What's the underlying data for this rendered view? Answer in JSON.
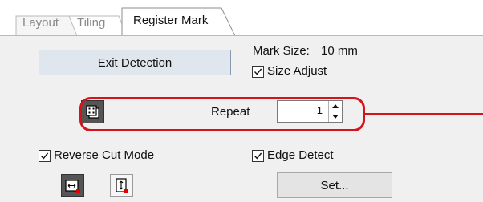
{
  "tabs": [
    {
      "label": "Layout",
      "active": false
    },
    {
      "label": "Tiling",
      "active": false
    },
    {
      "label": "Register Mark",
      "active": true
    }
  ],
  "exit_button": {
    "label": "Exit Detection"
  },
  "mark_size": {
    "label": "Mark Size:",
    "value": "10 mm"
  },
  "size_adjust": {
    "label": "Size Adjust",
    "checked": true
  },
  "repeat": {
    "label": "Repeat",
    "value": "1",
    "icon": "copies-icon"
  },
  "reverse_cut_mode": {
    "label": "Reverse Cut Mode",
    "checked": true
  },
  "edge_detect": {
    "label": "Edge Detect",
    "checked": true
  },
  "set_button": {
    "label": "Set..."
  },
  "direction_icons": [
    "horizontal-direction-icon",
    "vertical-direction-icon"
  ],
  "colors": {
    "highlight": "#d4141b",
    "panel": "#f0f0f0",
    "accent_dot": "#e00000"
  }
}
